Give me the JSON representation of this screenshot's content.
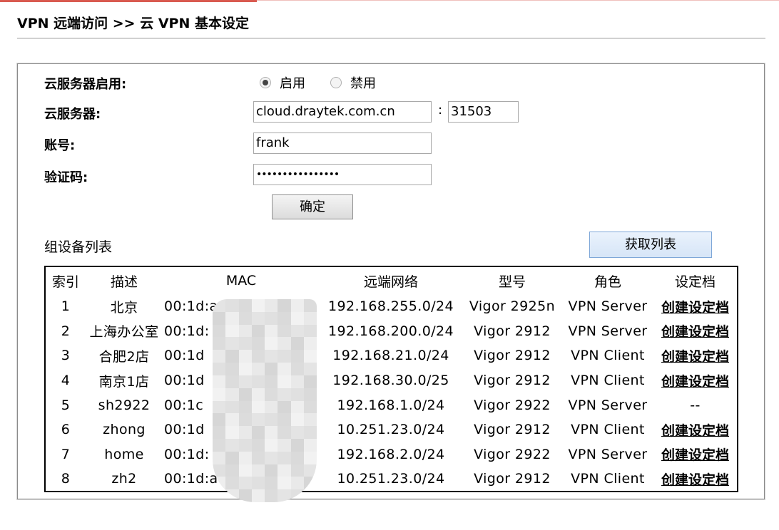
{
  "page_title": "VPN 远端访问 >> 云 VPN 基本设定",
  "form": {
    "enable_label": "云服务器启用:",
    "enable_options": [
      "启用",
      "禁用"
    ],
    "enable_selected": "启用",
    "server_label": "云服务器:",
    "server_host": "cloud.draytek.com.cn",
    "server_colon": ":",
    "server_port": "31503",
    "account_label": "账号:",
    "account_value": "frank",
    "password_label": "验证码:",
    "password_value": "••••••••••••••••",
    "confirm_button": "确定"
  },
  "device_list": {
    "title": "组设备列表",
    "fetch_button": "获取列表",
    "columns": [
      "索引",
      "描述",
      "MAC",
      "远端网络",
      "型号",
      "角色",
      "设定档"
    ],
    "rows": [
      {
        "index": "1",
        "desc": "北京",
        "mac": "00:1d:a",
        "network": "192.168.255.0/24",
        "model": "Vigor 2925n",
        "role": "VPN Server",
        "profile": "创建设定档"
      },
      {
        "index": "2",
        "desc": "上海办公室",
        "mac": "00:1d:",
        "network": "192.168.200.0/24",
        "model": "Vigor 2912",
        "role": "VPN Server",
        "profile": "创建设定档"
      },
      {
        "index": "3",
        "desc": "合肥2店",
        "mac": "00:1d",
        "network": "192.168.21.0/24",
        "model": "Vigor 2912",
        "role": "VPN Client",
        "profile": "创建设定档"
      },
      {
        "index": "4",
        "desc": "南京1店",
        "mac": "00:1d",
        "network": "192.168.30.0/25",
        "model": "Vigor 2912",
        "role": "VPN Client",
        "profile": "创建设定档"
      },
      {
        "index": "5",
        "desc": "sh2922",
        "mac": "00:1c",
        "network": "192.168.1.0/24",
        "model": "Vigor 2922",
        "role": "VPN Server",
        "profile": "--"
      },
      {
        "index": "6",
        "desc": "zhong",
        "mac": "00:1d",
        "network": "10.251.23.0/24",
        "model": "Vigor 2912",
        "role": "VPN Client",
        "profile": "创建设定档"
      },
      {
        "index": "7",
        "desc": "home",
        "mac": "00:1d:",
        "network": "192.168.2.0/24",
        "model": "Vigor 2922",
        "role": "VPN Server",
        "profile": "创建设定档"
      },
      {
        "index": "8",
        "desc": "zh2",
        "mac": "00:1d:aa",
        "network": "10.251.23.0/24",
        "model": "Vigor 2912",
        "role": "VPN Client",
        "profile": "创建设定档"
      }
    ]
  },
  "colors": {
    "accent_line": "#d95a50",
    "button_blue": "#d6e5f7"
  }
}
